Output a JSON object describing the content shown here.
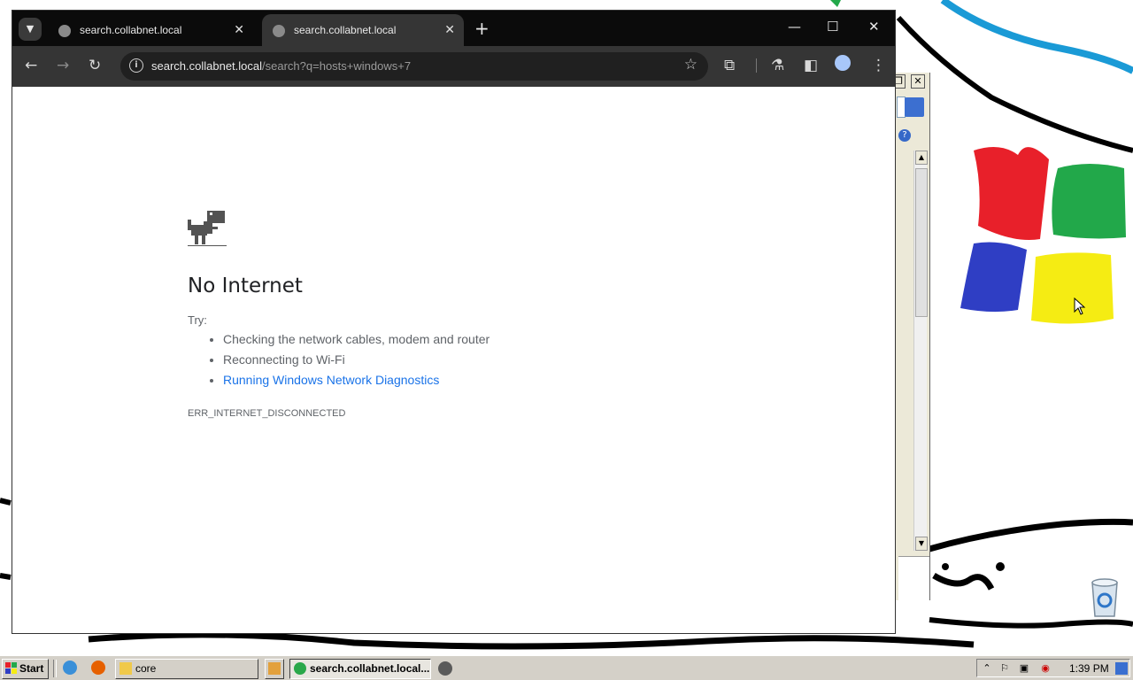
{
  "browser": {
    "tabs": [
      {
        "title": "search.collabnet.local",
        "active": false
      },
      {
        "title": "search.collabnet.local",
        "active": true
      }
    ],
    "url_host": "search.collabnet.local",
    "url_path": "/search?q=hosts+windows+7"
  },
  "error_page": {
    "title": "No Internet",
    "try_label": "Try:",
    "suggestions": [
      "Checking the network cables, modem and router",
      "Reconnecting to Wi-Fi",
      "Running Windows Network Diagnostics"
    ],
    "error_code": "ERR_INTERNET_DISCONNECTED"
  },
  "taskbar": {
    "start_label": "Start",
    "tasks": [
      {
        "label": "core",
        "active": false
      },
      {
        "label": "search.collabnet.local...",
        "active": true
      }
    ],
    "clock": "1:39 PM"
  },
  "icons": {
    "tab_favicon": "globe-icon",
    "desktop": "recycle-bin-icon"
  },
  "colors": {
    "link": "#1a73e8",
    "titlebar": "#0b0b0b",
    "toolbar": "#353535",
    "taskbar": "#d4d0c8"
  }
}
